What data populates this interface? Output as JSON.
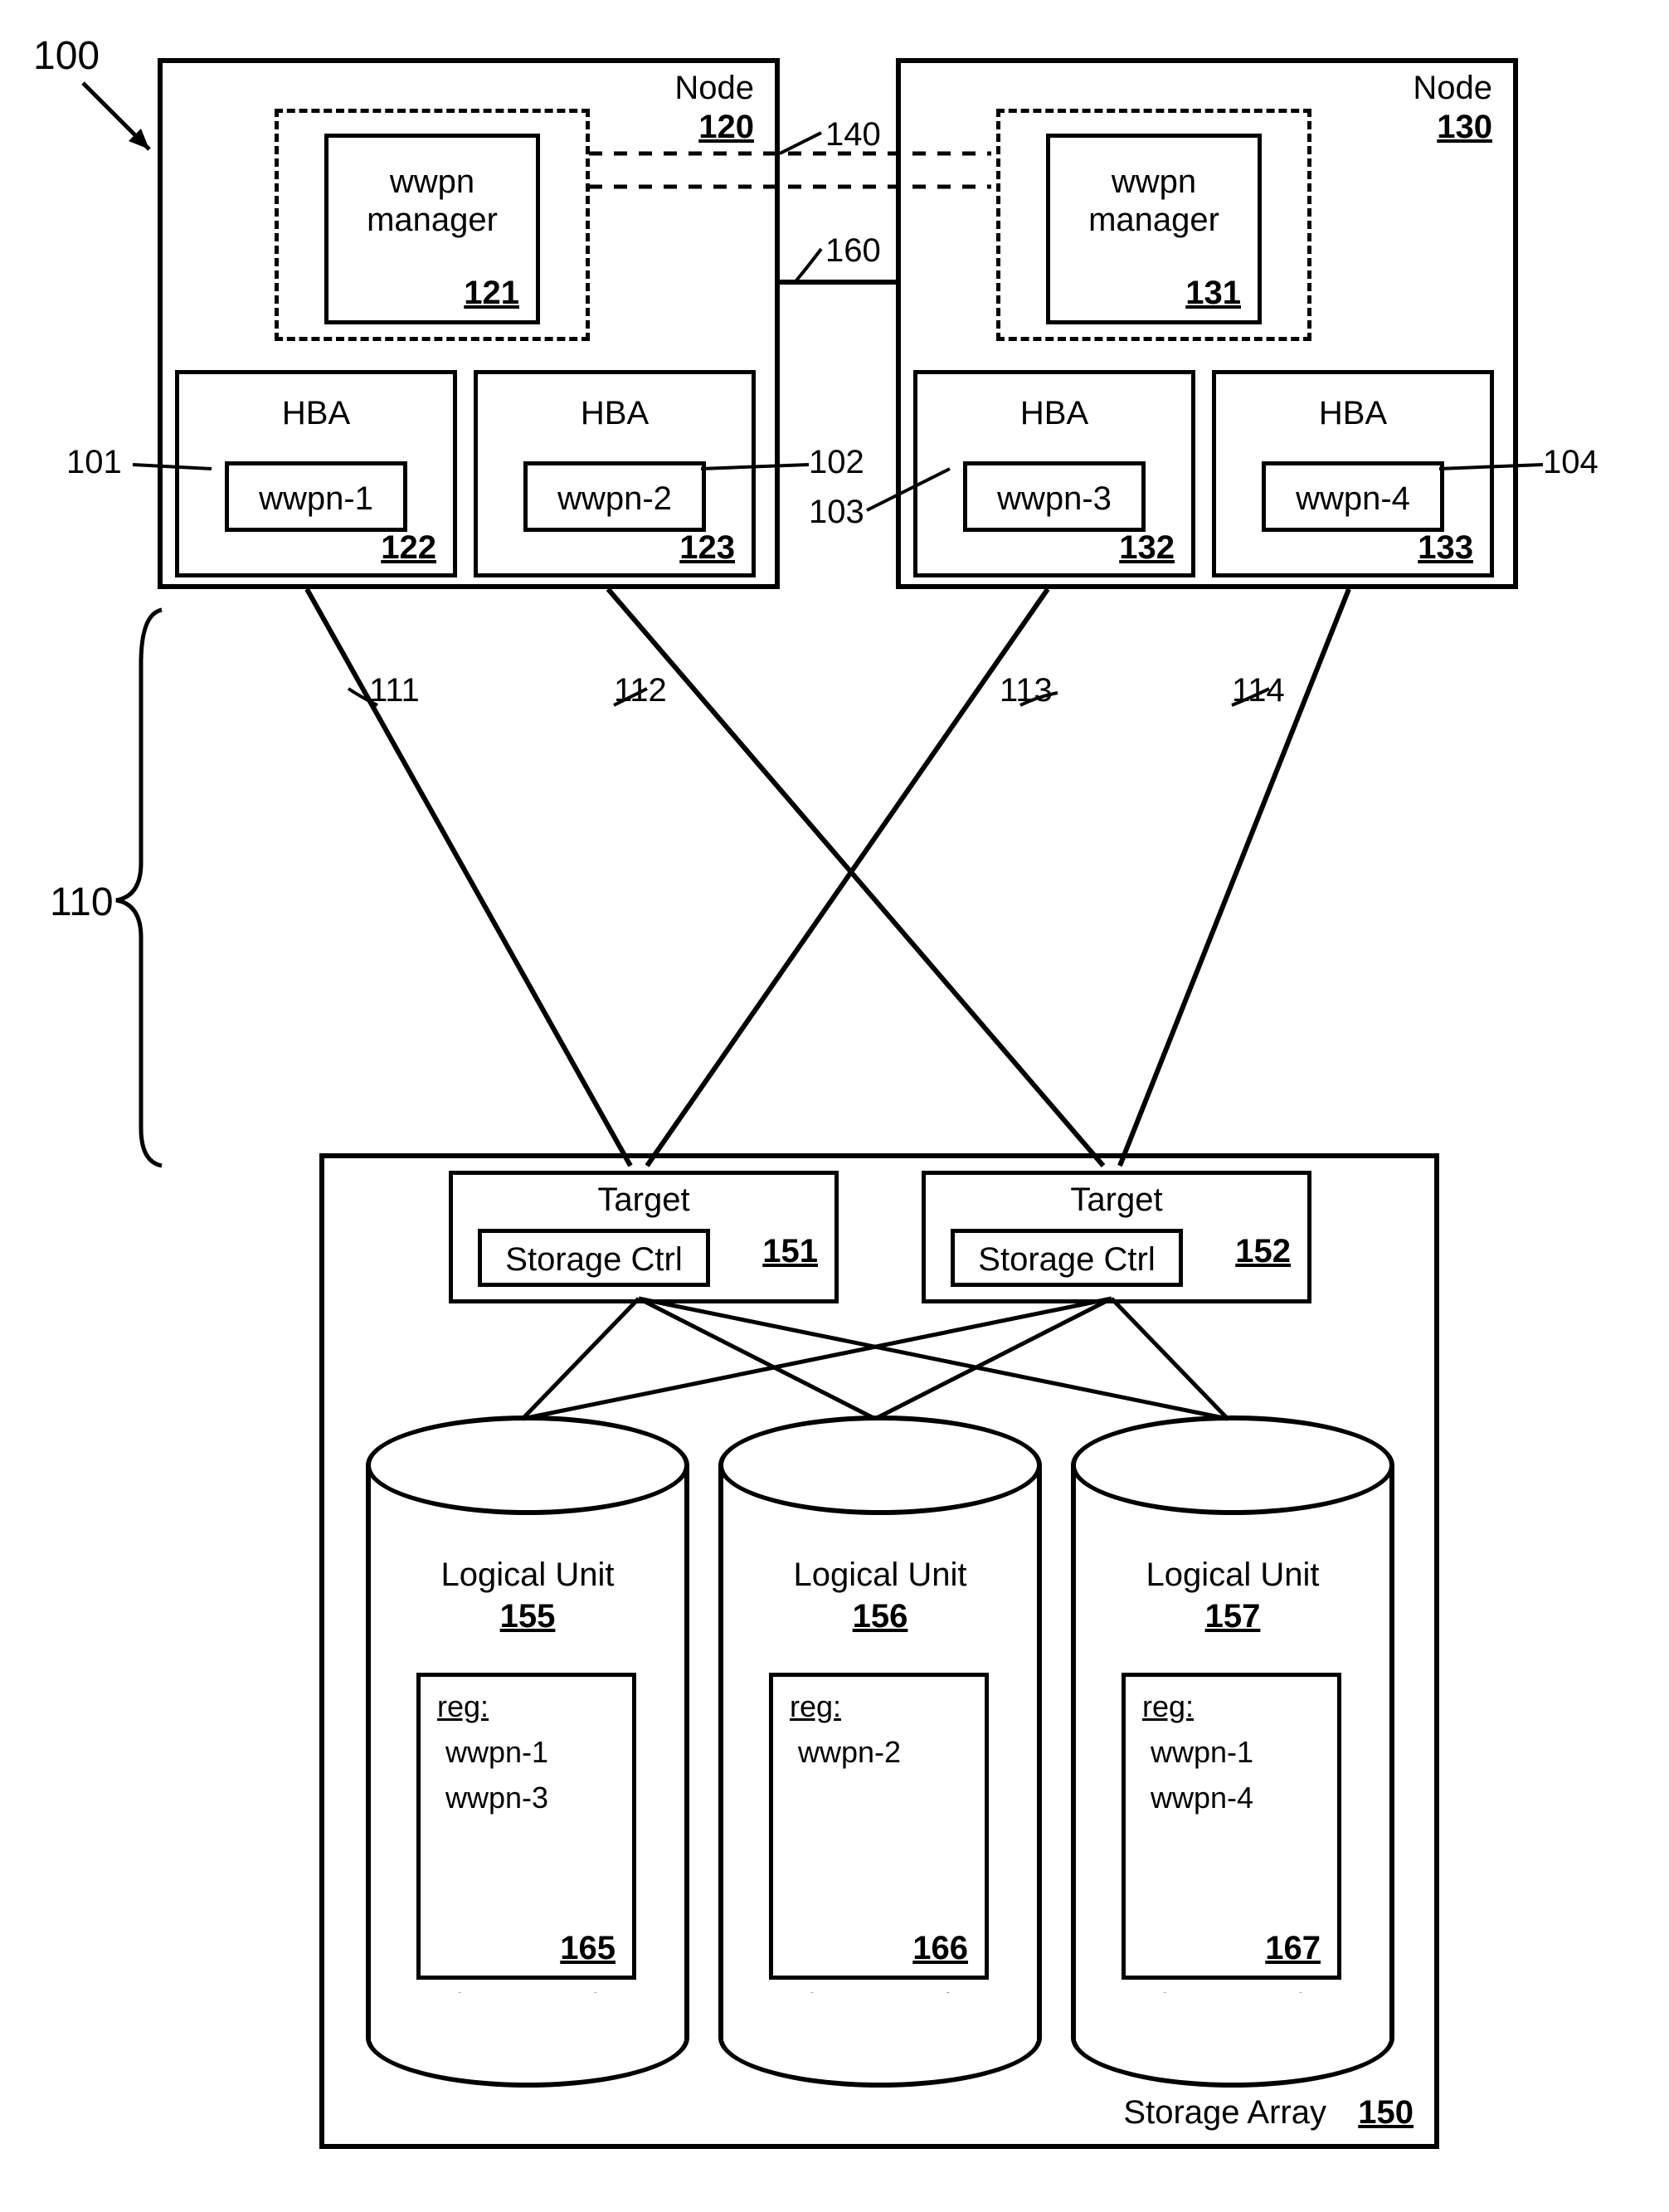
{
  "system_id": "100",
  "node120": {
    "title": "Node",
    "id": "120"
  },
  "node130": {
    "title": "Node",
    "id": "130"
  },
  "wwpn_mgr_121": {
    "title": "wwpn\nmanager",
    "id": "121"
  },
  "wwpn_mgr_131": {
    "title": "wwpn\nmanager",
    "id": "131"
  },
  "hba_122": {
    "title": "HBA",
    "id": "122"
  },
  "hba_123": {
    "title": "HBA",
    "id": "123"
  },
  "hba_132": {
    "title": "HBA",
    "id": "132"
  },
  "hba_133": {
    "title": "HBA",
    "id": "133"
  },
  "wwpn1": {
    "label": "wwpn-1",
    "callout": "101"
  },
  "wwpn2": {
    "label": "wwpn-2",
    "callout": "102"
  },
  "wwpn3": {
    "label": "wwpn-3",
    "callout": "103"
  },
  "wwpn4": {
    "label": "wwpn-4",
    "callout": "104"
  },
  "fabric_id": "110",
  "link_111": "111",
  "link_112": "112",
  "link_113": "113",
  "link_114": "114",
  "link_140": "140",
  "link_160": "160",
  "storage_array": {
    "title": "Storage Array",
    "id": "150"
  },
  "target_151": {
    "title": "Target",
    "ctrl": "Storage Ctrl",
    "id": "151"
  },
  "target_152": {
    "title": "Target",
    "ctrl": "Storage Ctrl",
    "id": "152"
  },
  "lu_155": {
    "title": "Logical Unit",
    "id": "155",
    "reg_label": "reg:",
    "regs": [
      "wwpn-1",
      "wwpn-3"
    ],
    "reg_id": "165"
  },
  "lu_156": {
    "title": "Logical Unit",
    "id": "156",
    "reg_label": "reg:",
    "regs": [
      "wwpn-2"
    ],
    "reg_id": "166"
  },
  "lu_157": {
    "title": "Logical Unit",
    "id": "157",
    "reg_label": "reg:",
    "regs": [
      "wwpn-1",
      "wwpn-4"
    ],
    "reg_id": "167"
  }
}
